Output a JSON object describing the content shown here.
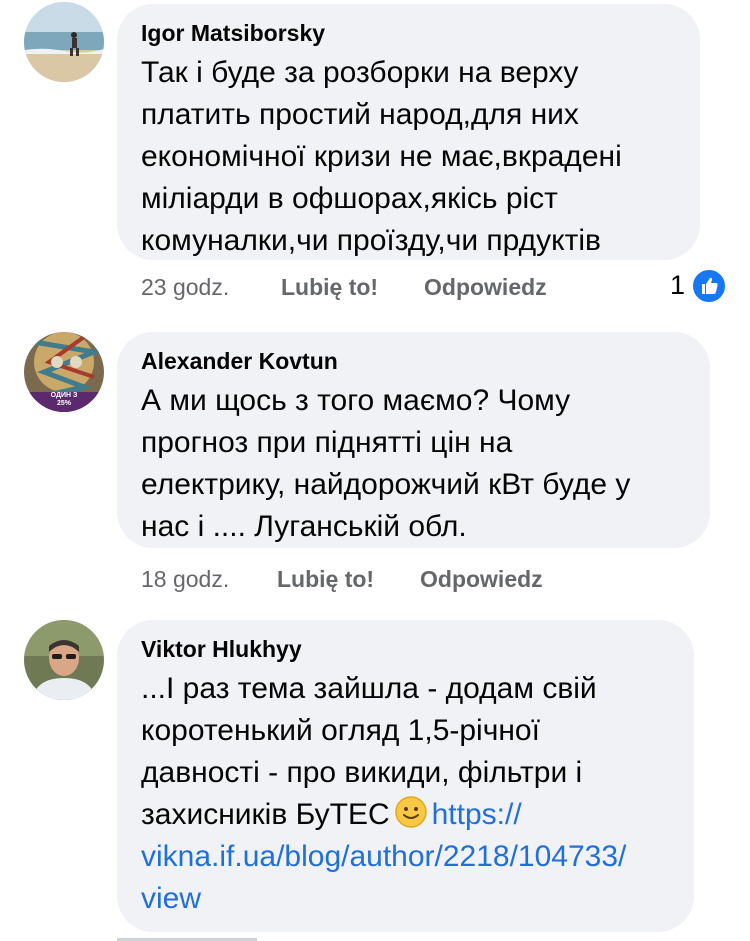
{
  "comments": [
    {
      "author": "Igor Matsiborsky",
      "text": "Так і буде за розборки на верху\nплатить простий народ,для них\nекономічної кризи не має,вкрадені\nміліарди в офшорах,якісь ріст\nкомуналки,чи проїзду,чи прдуктів",
      "time": "23 godz.",
      "like_label": "Lubię to!",
      "reply_label": "Odpowiedz",
      "reaction_count": "1",
      "avatar": "beach-photo"
    },
    {
      "author": "Alexander Kovtun",
      "text": "А ми щось з того маємо? Чому\nпрогноз при піднятті цін на\nелектрику, найдорожчий кВт буде у\nнас і .... Луганській обл.",
      "time": "18 godz.",
      "like_label": "Lubię to!",
      "reply_label": "Odpowiedz",
      "avatar": "artwork-photo",
      "avatar_badge_line1": "ОДИН З",
      "avatar_badge_line2": "25%"
    },
    {
      "author": "Viktor Hlukhyy",
      "text_part1": "...І раз тема зайшла - додам свій\nкоротенький огляд 1,5-річної\nдавності - про викиди, фільтри і\nзахисників БуТЕС",
      "emoji": "slightly-smiling-face",
      "link_part1": "https://",
      "link_part2": "vikna.if.ua/blog/author/2218/104733/",
      "link_part3": "view",
      "avatar": "man-with-sunglasses-photo"
    }
  ],
  "colors": {
    "bubble": "#f0f2f5",
    "link": "#216fdb",
    "meta": "#65676b",
    "like_badge": "#1877f2"
  }
}
